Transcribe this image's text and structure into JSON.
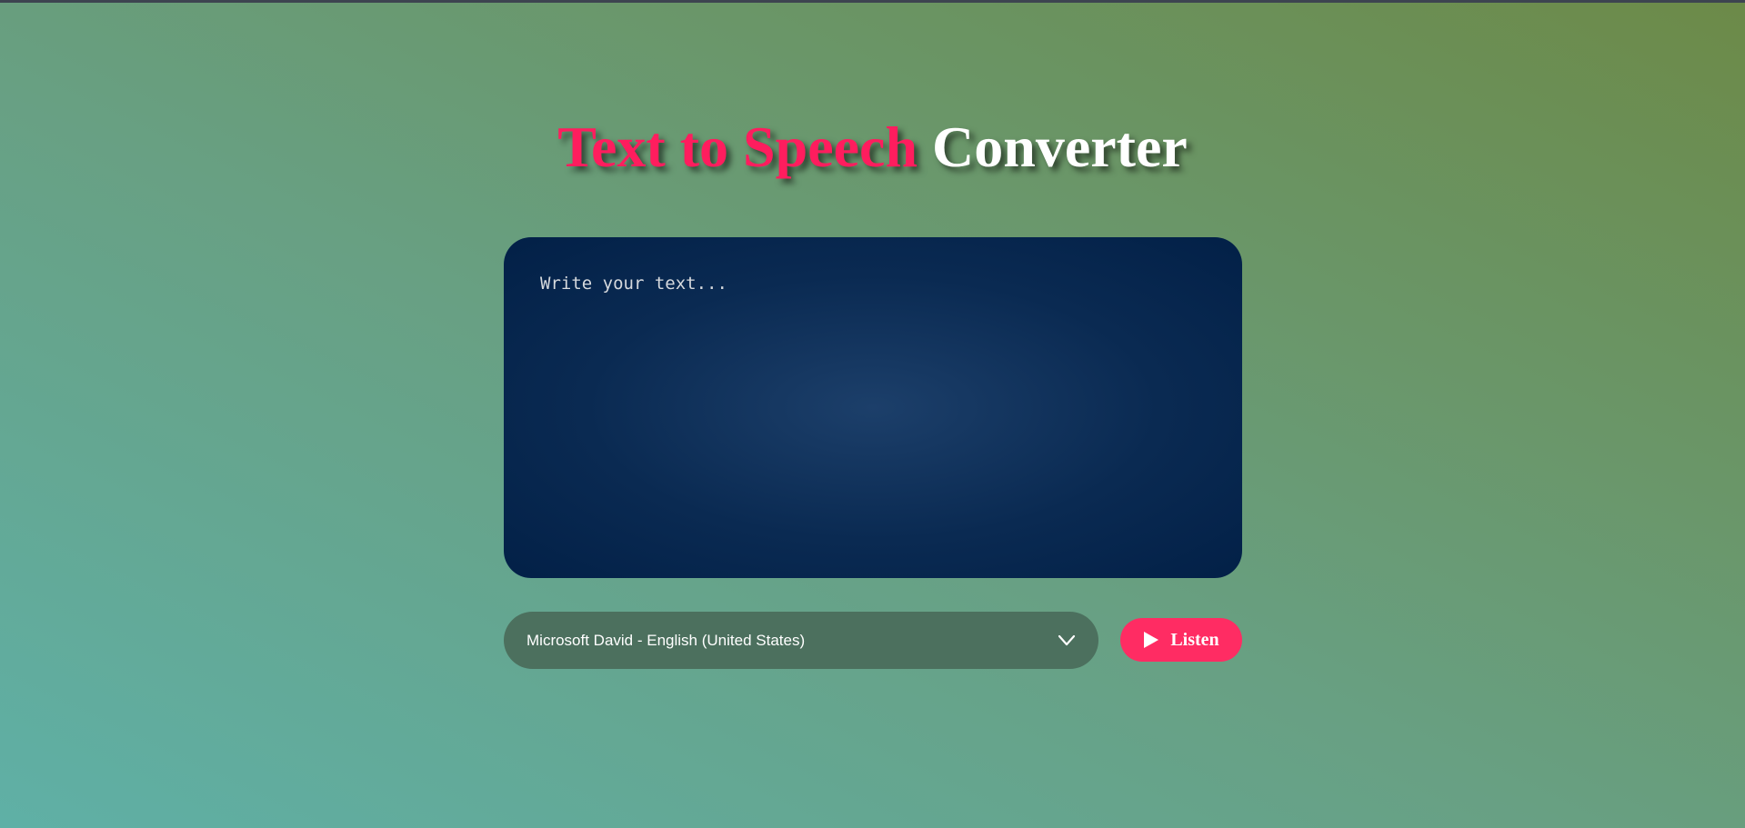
{
  "header": {
    "title_accent": "Text to Speech",
    "title_rest": "Converter"
  },
  "editor": {
    "placeholder": "Write your text...",
    "value": ""
  },
  "voice_select": {
    "selected": "Microsoft David - English (United States)",
    "icon": "chevron-down-icon"
  },
  "listen_button": {
    "label": "Listen",
    "icon": "play-icon"
  },
  "colors": {
    "accent": "#ff1d5e",
    "button": "#ff2c63",
    "editor_bg": "#0a2a52",
    "select_bg": "#4c705e"
  }
}
